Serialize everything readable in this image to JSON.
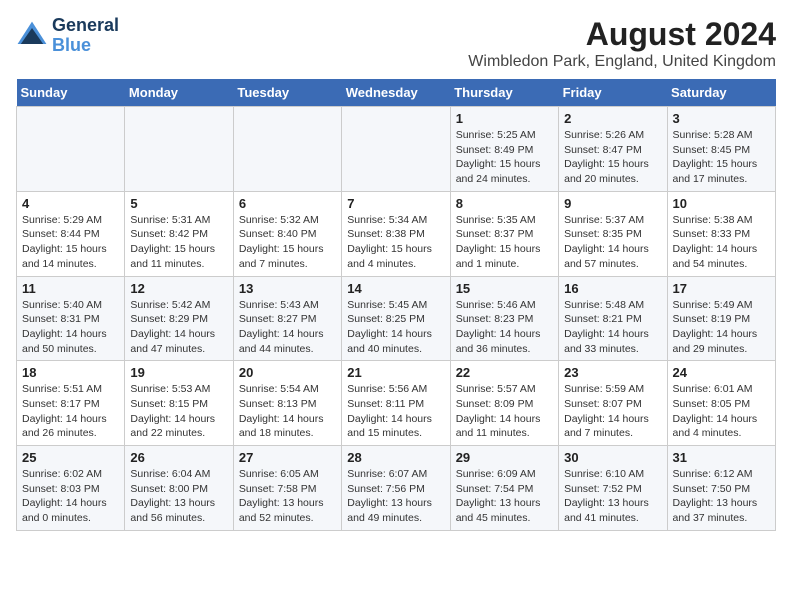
{
  "header": {
    "logo_line1": "General",
    "logo_line2": "Blue",
    "title": "August 2024",
    "subtitle": "Wimbledon Park, England, United Kingdom"
  },
  "columns": [
    "Sunday",
    "Monday",
    "Tuesday",
    "Wednesday",
    "Thursday",
    "Friday",
    "Saturday"
  ],
  "weeks": [
    [
      {
        "day": "",
        "info": ""
      },
      {
        "day": "",
        "info": ""
      },
      {
        "day": "",
        "info": ""
      },
      {
        "day": "",
        "info": ""
      },
      {
        "day": "1",
        "info": "Sunrise: 5:25 AM\nSunset: 8:49 PM\nDaylight: 15 hours\nand 24 minutes."
      },
      {
        "day": "2",
        "info": "Sunrise: 5:26 AM\nSunset: 8:47 PM\nDaylight: 15 hours\nand 20 minutes."
      },
      {
        "day": "3",
        "info": "Sunrise: 5:28 AM\nSunset: 8:45 PM\nDaylight: 15 hours\nand 17 minutes."
      }
    ],
    [
      {
        "day": "4",
        "info": "Sunrise: 5:29 AM\nSunset: 8:44 PM\nDaylight: 15 hours\nand 14 minutes."
      },
      {
        "day": "5",
        "info": "Sunrise: 5:31 AM\nSunset: 8:42 PM\nDaylight: 15 hours\nand 11 minutes."
      },
      {
        "day": "6",
        "info": "Sunrise: 5:32 AM\nSunset: 8:40 PM\nDaylight: 15 hours\nand 7 minutes."
      },
      {
        "day": "7",
        "info": "Sunrise: 5:34 AM\nSunset: 8:38 PM\nDaylight: 15 hours\nand 4 minutes."
      },
      {
        "day": "8",
        "info": "Sunrise: 5:35 AM\nSunset: 8:37 PM\nDaylight: 15 hours\nand 1 minute."
      },
      {
        "day": "9",
        "info": "Sunrise: 5:37 AM\nSunset: 8:35 PM\nDaylight: 14 hours\nand 57 minutes."
      },
      {
        "day": "10",
        "info": "Sunrise: 5:38 AM\nSunset: 8:33 PM\nDaylight: 14 hours\nand 54 minutes."
      }
    ],
    [
      {
        "day": "11",
        "info": "Sunrise: 5:40 AM\nSunset: 8:31 PM\nDaylight: 14 hours\nand 50 minutes."
      },
      {
        "day": "12",
        "info": "Sunrise: 5:42 AM\nSunset: 8:29 PM\nDaylight: 14 hours\nand 47 minutes."
      },
      {
        "day": "13",
        "info": "Sunrise: 5:43 AM\nSunset: 8:27 PM\nDaylight: 14 hours\nand 44 minutes."
      },
      {
        "day": "14",
        "info": "Sunrise: 5:45 AM\nSunset: 8:25 PM\nDaylight: 14 hours\nand 40 minutes."
      },
      {
        "day": "15",
        "info": "Sunrise: 5:46 AM\nSunset: 8:23 PM\nDaylight: 14 hours\nand 36 minutes."
      },
      {
        "day": "16",
        "info": "Sunrise: 5:48 AM\nSunset: 8:21 PM\nDaylight: 14 hours\nand 33 minutes."
      },
      {
        "day": "17",
        "info": "Sunrise: 5:49 AM\nSunset: 8:19 PM\nDaylight: 14 hours\nand 29 minutes."
      }
    ],
    [
      {
        "day": "18",
        "info": "Sunrise: 5:51 AM\nSunset: 8:17 PM\nDaylight: 14 hours\nand 26 minutes."
      },
      {
        "day": "19",
        "info": "Sunrise: 5:53 AM\nSunset: 8:15 PM\nDaylight: 14 hours\nand 22 minutes."
      },
      {
        "day": "20",
        "info": "Sunrise: 5:54 AM\nSunset: 8:13 PM\nDaylight: 14 hours\nand 18 minutes."
      },
      {
        "day": "21",
        "info": "Sunrise: 5:56 AM\nSunset: 8:11 PM\nDaylight: 14 hours\nand 15 minutes."
      },
      {
        "day": "22",
        "info": "Sunrise: 5:57 AM\nSunset: 8:09 PM\nDaylight: 14 hours\nand 11 minutes."
      },
      {
        "day": "23",
        "info": "Sunrise: 5:59 AM\nSunset: 8:07 PM\nDaylight: 14 hours\nand 7 minutes."
      },
      {
        "day": "24",
        "info": "Sunrise: 6:01 AM\nSunset: 8:05 PM\nDaylight: 14 hours\nand 4 minutes."
      }
    ],
    [
      {
        "day": "25",
        "info": "Sunrise: 6:02 AM\nSunset: 8:03 PM\nDaylight: 14 hours\nand 0 minutes."
      },
      {
        "day": "26",
        "info": "Sunrise: 6:04 AM\nSunset: 8:00 PM\nDaylight: 13 hours\nand 56 minutes."
      },
      {
        "day": "27",
        "info": "Sunrise: 6:05 AM\nSunset: 7:58 PM\nDaylight: 13 hours\nand 52 minutes."
      },
      {
        "day": "28",
        "info": "Sunrise: 6:07 AM\nSunset: 7:56 PM\nDaylight: 13 hours\nand 49 minutes."
      },
      {
        "day": "29",
        "info": "Sunrise: 6:09 AM\nSunset: 7:54 PM\nDaylight: 13 hours\nand 45 minutes."
      },
      {
        "day": "30",
        "info": "Sunrise: 6:10 AM\nSunset: 7:52 PM\nDaylight: 13 hours\nand 41 minutes."
      },
      {
        "day": "31",
        "info": "Sunrise: 6:12 AM\nSunset: 7:50 PM\nDaylight: 13 hours\nand 37 minutes."
      }
    ]
  ]
}
